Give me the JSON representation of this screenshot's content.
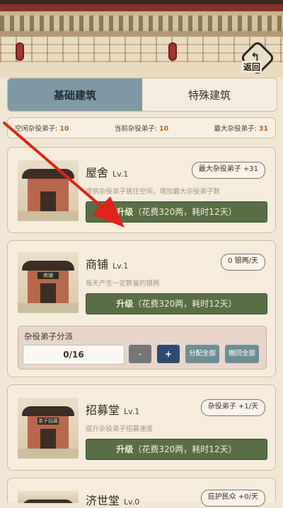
{
  "header": {
    "back_label": "返回"
  },
  "tabs": [
    {
      "label": "基础建筑",
      "active": true
    },
    {
      "label": "特殊建筑",
      "active": false
    }
  ],
  "stats": {
    "idle_label": "空闲杂役弟子:",
    "idle_value": "10",
    "current_label": "当前杂役弟子:",
    "current_value": "10",
    "max_label": "最大杂役弟子:",
    "max_value": "31"
  },
  "buildings": [
    {
      "name": "屋舍",
      "level": "Lv.1",
      "badge": "最大杂役弟子 +31",
      "desc": "提供杂役弟子居住空间，增加最大杂役弟子数",
      "upgrade_label": "升级",
      "upgrade_cost": "（花费320两，耗时12天）",
      "sign": ""
    },
    {
      "name": "商铺",
      "level": "Lv.1",
      "badge": "0 银两/天",
      "desc": "每天产生一定数量的银两",
      "upgrade_label": "升级",
      "upgrade_cost": "（花费320两，耗时12天）",
      "sign": "商铺",
      "assign": {
        "title": "杂役弟子分派",
        "value": "0/16",
        "minus": "-",
        "plus": "+",
        "all": "分配全部",
        "recall": "撤回全部"
      }
    },
    {
      "name": "招募堂",
      "level": "Lv.1",
      "badge": "杂役弟子 +1/天",
      "desc": "提升杂役弟子招募速度",
      "upgrade_label": "升级",
      "upgrade_cost": "（花费320两，耗时12天）",
      "sign": "弟子招募"
    },
    {
      "name": "济世堂",
      "level": "Lv.0",
      "badge": "庇护民众 +0/天"
    }
  ]
}
